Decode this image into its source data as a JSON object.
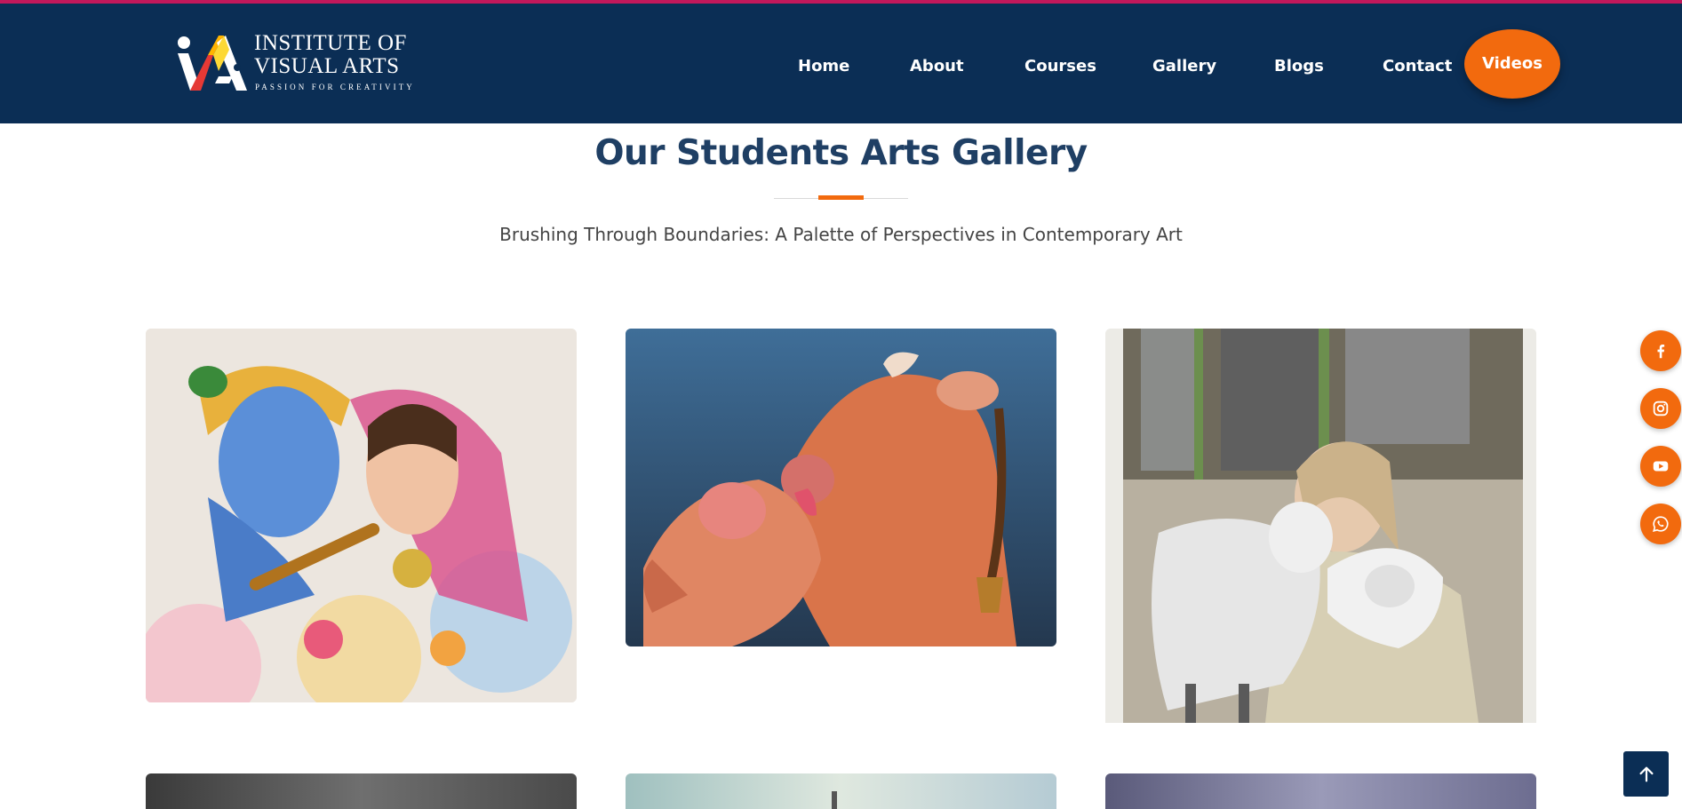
{
  "brand": {
    "line1": "INSTITUTE OF",
    "line2": "VISUAL ARTS",
    "tagline": "PASSION FOR CREATIVITY"
  },
  "nav": {
    "home": "Home",
    "about": "About",
    "courses": "Courses",
    "gallery": "Gallery",
    "blogs": "Blogs",
    "contact": "Contact",
    "videos": "Videos"
  },
  "section": {
    "title": "Our Students Arts Gallery",
    "subtitle": "Brushing Through Boundaries: A Palette of Perspectives in Contemporary Art"
  },
  "gallery": {
    "items": [
      {
        "subject": "krishna-radha-painting"
      },
      {
        "subject": "cows-painting"
      },
      {
        "subject": "girl-with-lambs-painting"
      },
      {
        "subject": "dark-landscape-painting"
      },
      {
        "subject": "sky-landscape-painting"
      },
      {
        "subject": "purple-sky-painting"
      }
    ]
  },
  "social": [
    "facebook-icon",
    "instagram-icon",
    "youtube-icon",
    "whatsapp-icon"
  ],
  "colors": {
    "header_bg": "#0b2e55",
    "accent": "#f26a0e",
    "top_line": "#c2185b",
    "title": "#1f3f64"
  }
}
